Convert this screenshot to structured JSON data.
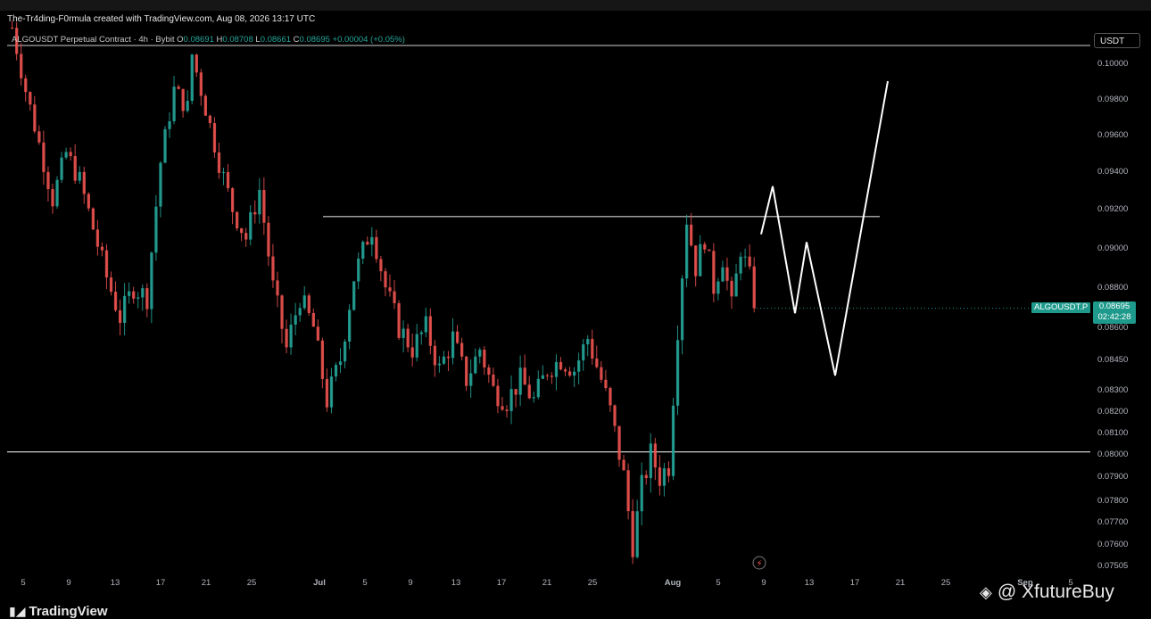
{
  "header": {
    "credit": "The-Tr4ding-F0rmula created with TradingView.com, Aug 08, 2026 13:17 UTC"
  },
  "legend": {
    "symbol": "ALGOUSDT Perpetual Contract · 4h · Bybit",
    "o_label": "O",
    "o": "0.08691",
    "h_label": "H",
    "h": "0.08708",
    "l_label": "L",
    "l": "0.08661",
    "c_label": "C",
    "c": "0.08695",
    "change": "+0.00004 (+0.05%)"
  },
  "price_axis": {
    "currency": "USDT",
    "symbol_tag": "ALGOUSDT.P",
    "last_price": "0.08695",
    "countdown": "02:42:28"
  },
  "footer": {
    "brand": "TradingView",
    "watermark": "@ XfutureBuy"
  },
  "colors": {
    "up": "#26a69a",
    "down": "#ef5350",
    "tag": "#1e9a8c",
    "lines": "#ffffff"
  },
  "chart_data": {
    "type": "candlestick",
    "symbol": "ALGOUSDT.P",
    "timeframe": "4h",
    "exchange": "Bybit",
    "last": 0.08695,
    "y_ticks": [
      "0.10000",
      "0.09800",
      "0.09600",
      "0.09400",
      "0.09200",
      "0.09000",
      "0.08800",
      "0.08600",
      "0.08450",
      "0.08300",
      "0.08200",
      "0.08100",
      "0.08000",
      "0.07900",
      "0.07800",
      "0.07700",
      "0.07600",
      "0.07505"
    ],
    "x_ticks": [
      "5",
      "9",
      "13",
      "17",
      "21",
      "25",
      "Jul",
      "5",
      "9",
      "13",
      "17",
      "21",
      "25",
      "Aug",
      "5",
      "9",
      "13",
      "17",
      "21",
      "25",
      "Sep",
      "5"
    ],
    "horizontal_levels": [
      0.101,
      0.0916,
      0.0801
    ],
    "close_path": [
      [
        0,
        0.102
      ],
      [
        3,
        0.0985
      ],
      [
        6,
        0.0955
      ],
      [
        9,
        0.0925
      ],
      [
        12,
        0.095
      ],
      [
        15,
        0.0935
      ],
      [
        18,
        0.091
      ],
      [
        21,
        0.0885
      ],
      [
        24,
        0.0865
      ],
      [
        27,
        0.088
      ],
      [
        30,
        0.0875
      ],
      [
        33,
        0.0945
      ],
      [
        36,
        0.0985
      ],
      [
        39,
        0.0975
      ],
      [
        40,
        0.1005
      ],
      [
        43,
        0.0975
      ],
      [
        46,
        0.0945
      ],
      [
        49,
        0.092
      ],
      [
        52,
        0.0905
      ],
      [
        55,
        0.093
      ],
      [
        58,
        0.088
      ],
      [
        61,
        0.085
      ],
      [
        64,
        0.0875
      ],
      [
        67,
        0.086
      ],
      [
        70,
        0.0825
      ],
      [
        73,
        0.0845
      ],
      [
        76,
        0.0885
      ],
      [
        79,
        0.0905
      ],
      [
        80,
        0.091
      ],
      [
        83,
        0.088
      ],
      [
        86,
        0.086
      ],
      [
        89,
        0.085
      ],
      [
        92,
        0.086
      ],
      [
        95,
        0.084
      ],
      [
        98,
        0.0855
      ],
      [
        101,
        0.0835
      ],
      [
        104,
        0.085
      ],
      [
        107,
        0.083
      ],
      [
        110,
        0.0825
      ],
      [
        113,
        0.0835
      ],
      [
        116,
        0.0825
      ],
      [
        119,
        0.084
      ],
      [
        122,
        0.0845
      ],
      [
        125,
        0.084
      ],
      [
        128,
        0.0855
      ],
      [
        131,
        0.0835
      ],
      [
        133,
        0.082
      ],
      [
        136,
        0.079
      ],
      [
        138,
        0.076
      ],
      [
        140,
        0.0785
      ],
      [
        142,
        0.08
      ],
      [
        144,
        0.079
      ],
      [
        146,
        0.0795
      ],
      [
        148,
        0.086
      ],
      [
        150,
        0.0915
      ],
      [
        152,
        0.089
      ],
      [
        154,
        0.0905
      ],
      [
        156,
        0.088
      ],
      [
        158,
        0.0895
      ],
      [
        160,
        0.087
      ],
      [
        162,
        0.09
      ],
      [
        164,
        0.0885
      ],
      [
        165,
        0.0868
      ]
    ],
    "projection": [
      {
        "date": "Aug 9",
        "price": 0.0907
      },
      {
        "date": "Aug 10",
        "price": 0.0932
      },
      {
        "date": "Aug 12",
        "price": 0.0867
      },
      {
        "date": "Aug 13",
        "price": 0.0903
      },
      {
        "date": "Aug 15",
        "price": 0.0837
      },
      {
        "date": "Aug 19",
        "price": 0.099
      }
    ]
  }
}
